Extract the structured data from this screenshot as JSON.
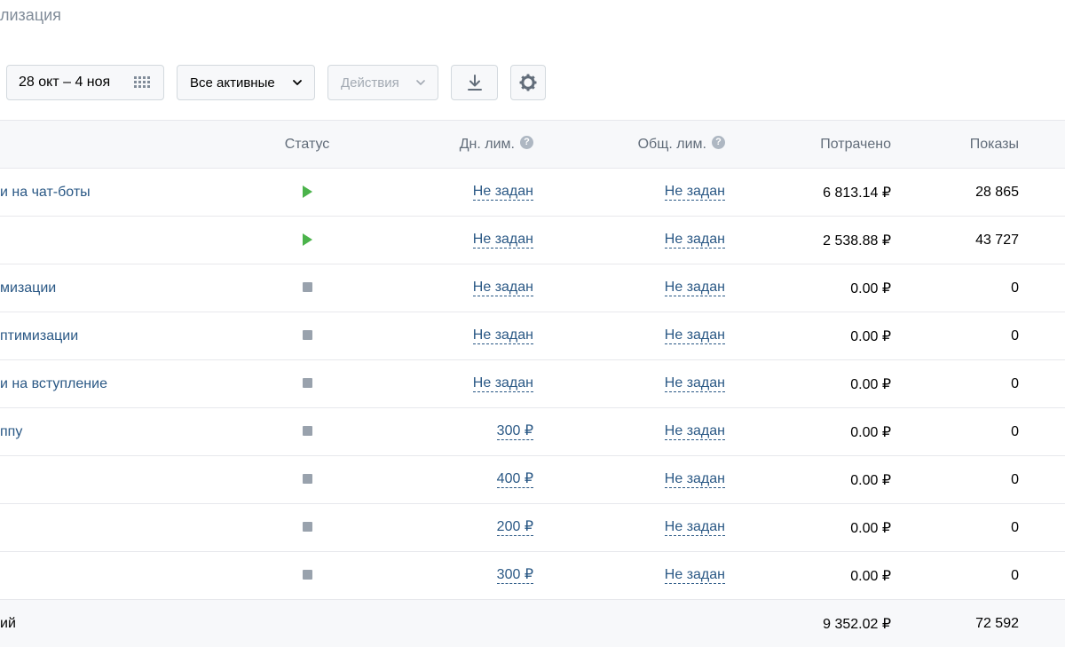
{
  "page": {
    "title": "лизация"
  },
  "toolbar": {
    "date_range": "28 окт – 4 ноя",
    "filter": "Все активные",
    "actions": "Действия"
  },
  "table": {
    "headers": {
      "status": "Статус",
      "daily_limit": "Дн. лим.",
      "total_limit": "Общ. лим.",
      "spent": "Потрачено",
      "shows": "Показы",
      "help": "?"
    },
    "rows": [
      {
        "name": "и на чат-боты",
        "status": "running",
        "daily_limit": "Не задан",
        "total_limit": "Не задан",
        "spent": "6 813.14 ₽",
        "shows": "28 865"
      },
      {
        "name": "",
        "status": "running",
        "daily_limit": "Не задан",
        "total_limit": "Не задан",
        "spent": "2 538.88 ₽",
        "shows": "43 727"
      },
      {
        "name": "мизации",
        "status": "stopped",
        "daily_limit": "Не задан",
        "total_limit": "Не задан",
        "spent": "0.00 ₽",
        "shows": "0"
      },
      {
        "name": "птимизации",
        "status": "stopped",
        "daily_limit": "Не задан",
        "total_limit": "Не задан",
        "spent": "0.00 ₽",
        "shows": "0"
      },
      {
        "name": "и на вступление",
        "status": "stopped",
        "daily_limit": "Не задан",
        "total_limit": "Не задан",
        "spent": "0.00 ₽",
        "shows": "0"
      },
      {
        "name": "ппу",
        "status": "stopped",
        "daily_limit": "300 ₽",
        "total_limit": "Не задан",
        "spent": "0.00 ₽",
        "shows": "0"
      },
      {
        "name": "",
        "status": "stopped",
        "daily_limit": "400 ₽",
        "total_limit": "Не задан",
        "spent": "0.00 ₽",
        "shows": "0"
      },
      {
        "name": "",
        "status": "stopped",
        "daily_limit": "200 ₽",
        "total_limit": "Не задан",
        "spent": "0.00 ₽",
        "shows": "0"
      },
      {
        "name": "",
        "status": "stopped",
        "daily_limit": "300 ₽",
        "total_limit": "Не задан",
        "spent": "0.00 ₽",
        "shows": "0"
      }
    ],
    "total": {
      "label": "ий",
      "spent": "9 352.02 ₽",
      "shows": "72 592"
    }
  },
  "colors": {
    "link": "#2a5885",
    "running": "#4bb34b",
    "stopped": "#99a2ad",
    "header_bg": "#f7f8fa"
  }
}
